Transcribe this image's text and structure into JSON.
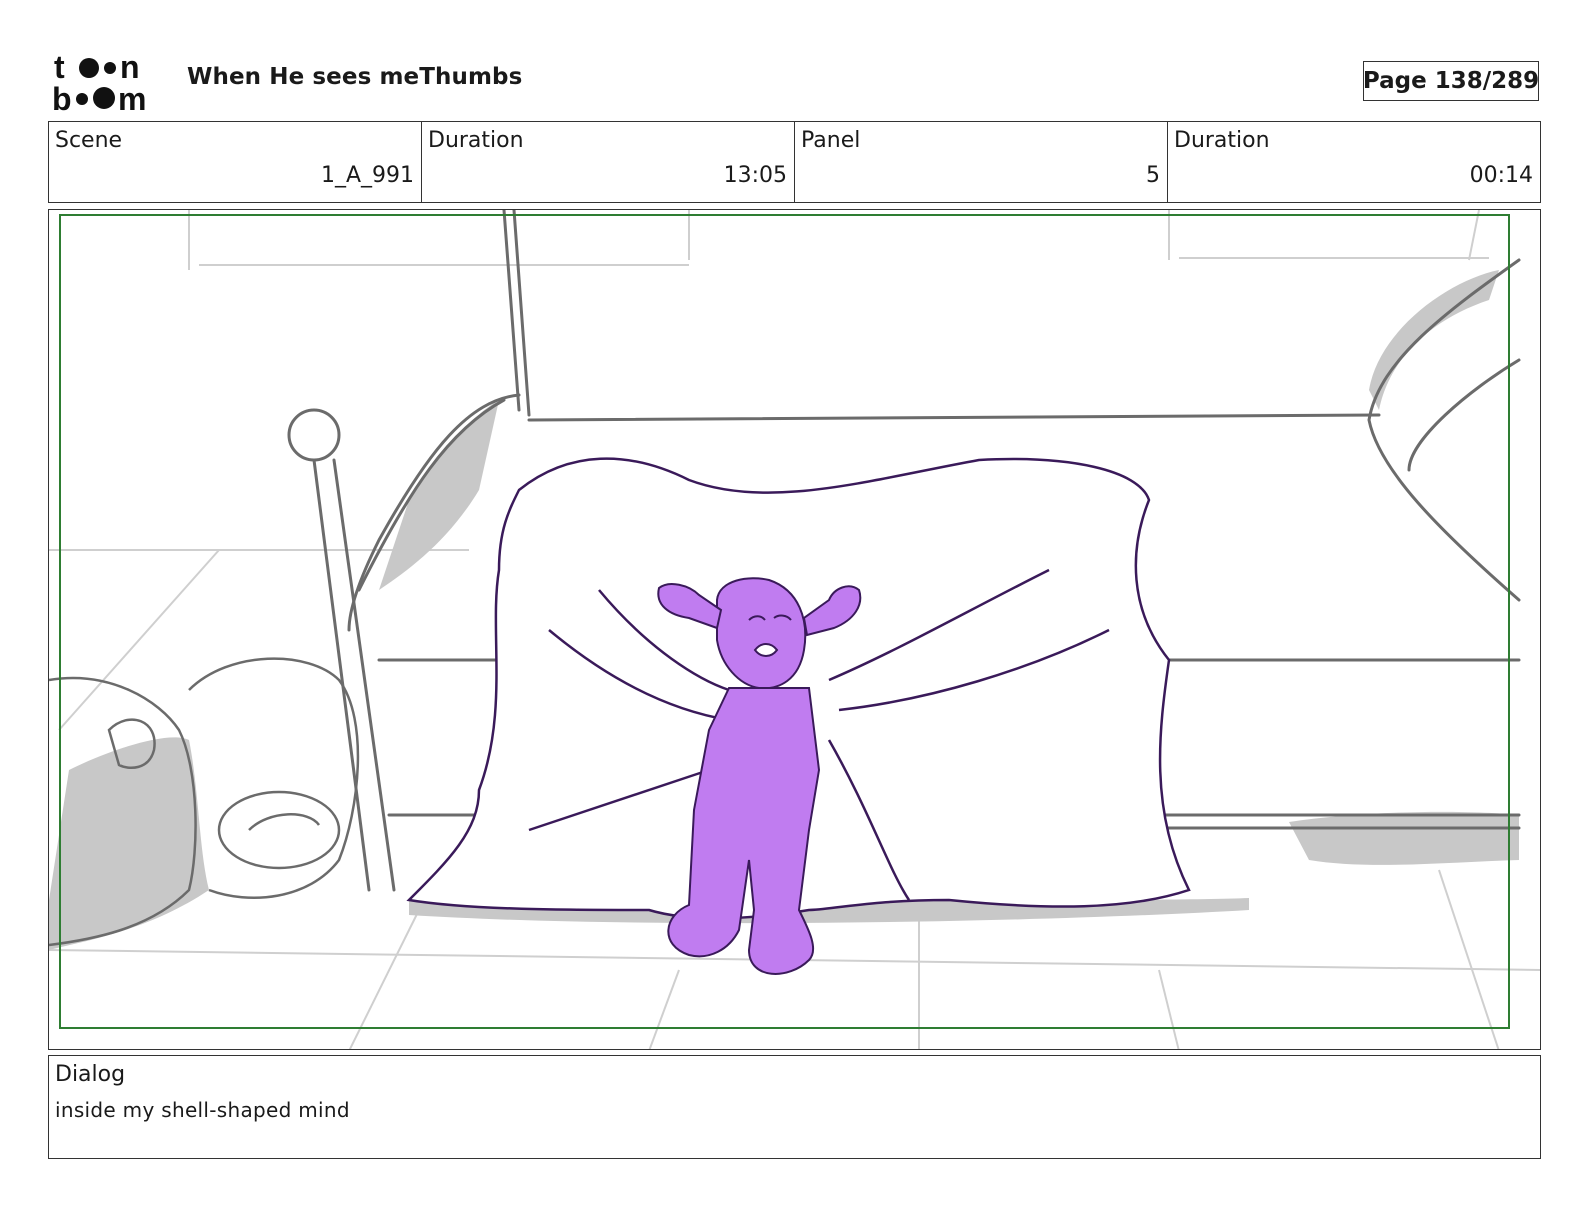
{
  "header": {
    "logo_text_top": "toon",
    "logo_text_bottom": "boom",
    "project_title": "When He sees meThumbs",
    "page_label": "Page 138/289"
  },
  "info": {
    "scene_label": "Scene",
    "scene_value": "1_A_991",
    "scene_duration_label": "Duration",
    "scene_duration_value": "13:05",
    "panel_label": "Panel",
    "panel_value": "5",
    "panel_duration_label": "Duration",
    "panel_duration_value": "00:14"
  },
  "drawing": {
    "description_icon": "storyboard-sketch",
    "frame_color": "#2e7d32",
    "character_color": "#c07cf0",
    "line_color": "#3a1a5a",
    "background_line_color": "#6b6b6b",
    "shadow_color": "#c8c8c8"
  },
  "dialog": {
    "label": "Dialog",
    "text": "inside my shell-shaped mind"
  }
}
